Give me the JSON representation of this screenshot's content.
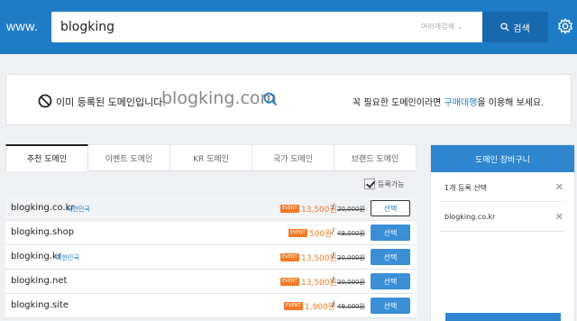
{
  "header": {
    "www_label": "www.",
    "search_value": "blogking",
    "search_type": "여러개검색",
    "search_button": "검색"
  },
  "notice": {
    "text": "이미 등록된 도메인입니다.",
    "domain": "blogking.com",
    "right_prefix": "꼭 필요한 도메인이라면 ",
    "right_link": "구매대행",
    "right_suffix": "을 이용해 보세요."
  },
  "tabs": [
    "추천 도메인",
    "이벤트 도메인",
    "KR 도메인",
    "국가 도메인",
    "브랜드 도메인"
  ],
  "filter_label": "등록가능",
  "event_badge": "EVENT",
  "slash": "/",
  "results": [
    {
      "domain": "blogking.co.kr",
      "tag": "대한민국",
      "price": "13,500원",
      "original": "20,000원",
      "button": "선택"
    },
    {
      "domain": "blogking.shop",
      "tag": "",
      "price": "500원",
      "original": "49,000원",
      "button": "선택"
    },
    {
      "domain": "blogking.kr",
      "tag": "대한민국",
      "price": "13,500원",
      "original": "20,000원",
      "button": "선택"
    },
    {
      "domain": "blogking.net",
      "tag": "",
      "price": "13,500원",
      "original": "20,000원",
      "button": "선택"
    },
    {
      "domain": "blogking.site",
      "tag": "",
      "price": "1,900원",
      "original": "49,000원",
      "button": "선택"
    }
  ],
  "cart": {
    "title": "도메인 장바구니",
    "count_text": "1개 등록 선택",
    "items": [
      "blogking.co.kr"
    ]
  },
  "colors": {
    "primary": "#1e7bc6",
    "event": "#f27a26"
  }
}
